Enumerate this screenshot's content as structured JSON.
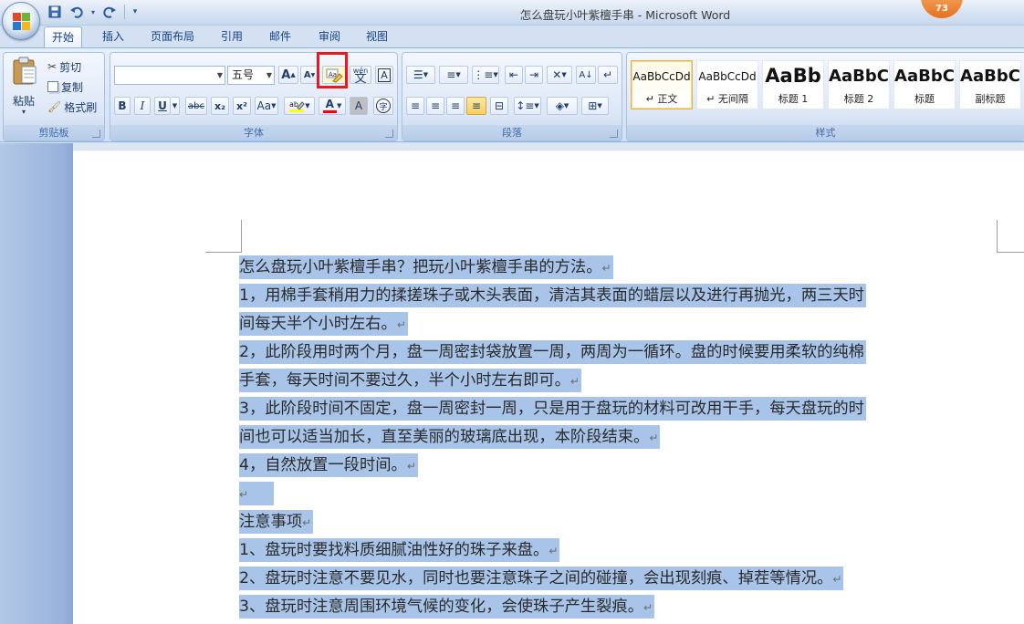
{
  "window": {
    "title": "怎么盘玩小叶紫檀手串 - Microsoft Word",
    "badge": "73"
  },
  "quick_access": {
    "save_icon": "save-icon",
    "undo_icon": "undo-icon",
    "redo_icon": "redo-icon"
  },
  "tabs": [
    {
      "label": "开始",
      "active": true
    },
    {
      "label": "插入"
    },
    {
      "label": "页面布局"
    },
    {
      "label": "引用"
    },
    {
      "label": "邮件"
    },
    {
      "label": "审阅"
    },
    {
      "label": "视图"
    }
  ],
  "ribbon": {
    "clipboard": {
      "label": "剪贴板",
      "paste": "粘贴",
      "cut": "剪切",
      "copy": "复制",
      "format_painter": "格式刷"
    },
    "font": {
      "label": "字体",
      "font_name": "",
      "font_size": "五号",
      "grow": "A",
      "shrink": "A",
      "phonetic": "wén",
      "border_char": "A",
      "bold": "B",
      "italic": "I",
      "underline": "U",
      "strike": "abc",
      "subscript": "x₂",
      "superscript": "x²",
      "change_case": "Aa",
      "shading_char": "A",
      "enclose": "字"
    },
    "paragraph": {
      "label": "段落"
    },
    "styles": {
      "label": "样式",
      "items": [
        {
          "sample": "AaBbCcDd",
          "name": "↵ 正文",
          "selected": true
        },
        {
          "sample": "AaBbCcDd",
          "name": "↵ 无间隔"
        },
        {
          "sample": "AaBb",
          "name": "标题 1"
        },
        {
          "sample": "AaBbC",
          "name": "标题 2"
        },
        {
          "sample": "AaBbC",
          "name": "标题"
        },
        {
          "sample": "AaBbC",
          "name": "副标题"
        }
      ]
    }
  },
  "document": {
    "lines": [
      "怎么盘玩小叶紫檀手串？把玩小叶紫檀手串的方法。",
      "1，用棉手套稍用力的揉搓珠子或木头表面，清洁其表面的蜡层以及进行再抛光，两三天时",
      "间每天半个小时左右。",
      "2，此阶段用时两个月，盘一周密封袋放置一周，两周为一循环。盘的时候要用柔软的纯棉",
      "手套，每天时间不要过久，半个小时左右即可。",
      "3，此阶段时间不固定，盘一周密封一周，只是用于盘玩的材料可改用干手，每天盘玩的时",
      "间也可以适当加长，直至美丽的玻璃底出现，本阶段结束。",
      "4，自然放置一段时间。",
      "",
      "注意事项",
      "1、盘玩时要找料质细腻油性好的珠子来盘。",
      "2、盘玩时注意不要见水，同时也要注意珠子之间的碰撞，会出现刻痕、掉茬等情况。",
      "3、盘玩时注意周围环境气候的变化，会使珠子产生裂痕。"
    ]
  },
  "colors": {
    "selection": "#a8c5e9",
    "highlight_box": "#e8191f"
  }
}
